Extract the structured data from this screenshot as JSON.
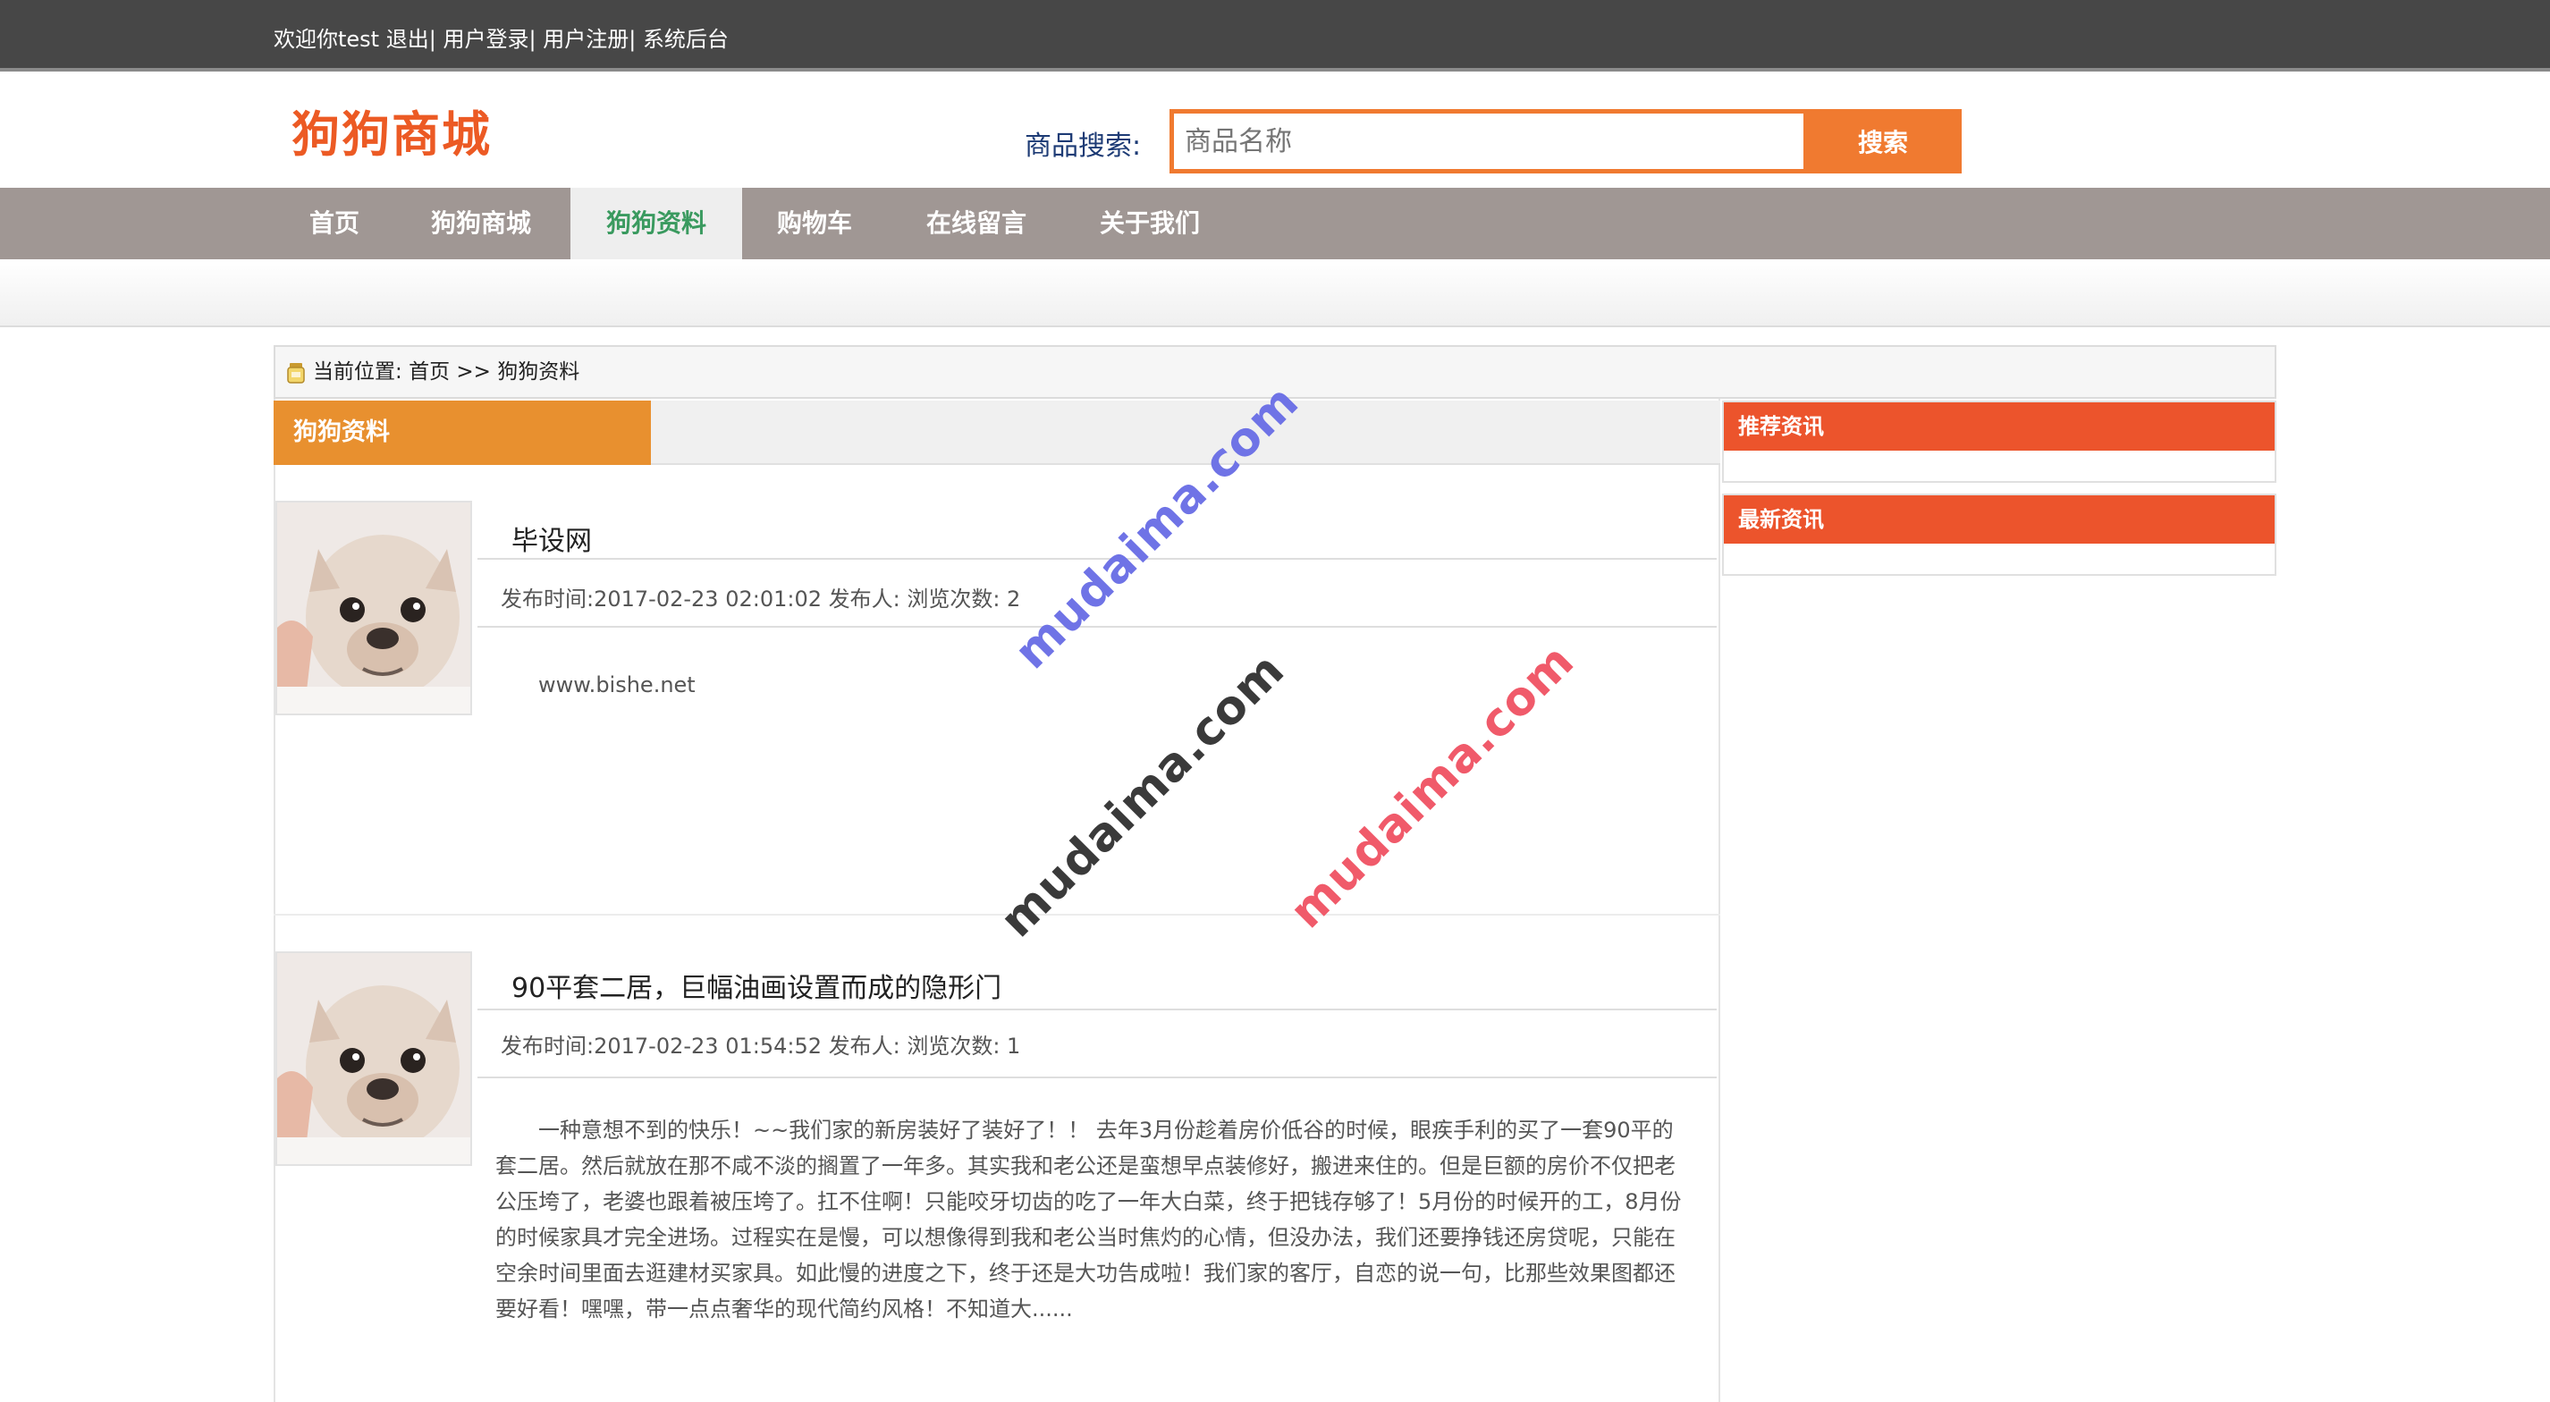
{
  "topbar": {
    "welcome": "欢迎你test",
    "logout": "退出",
    "sep1": "|",
    "login": "用户登录",
    "sep2": "|",
    "register": "用户注册",
    "sep3": "|",
    "admin": "系统后台"
  },
  "header": {
    "logo": "狗狗商城",
    "search_label": "商品搜索:",
    "search_placeholder": "商品名称",
    "search_button": "搜索"
  },
  "nav": {
    "items": [
      {
        "label": "首页"
      },
      {
        "label": "狗狗商城"
      },
      {
        "label": "狗狗资料",
        "active": true
      },
      {
        "label": "购物车"
      },
      {
        "label": "在线留言"
      },
      {
        "label": "关于我们"
      }
    ]
  },
  "breadcrumb": {
    "prefix": "当前位置:",
    "home": "首页",
    "arrow": ">>",
    "current": "狗狗资料"
  },
  "section": {
    "title": "狗狗资料"
  },
  "articles": [
    {
      "title": "毕设网",
      "meta": "发布时间:2017-02-23 02:01:02 发布人: 浏览次数: 2",
      "body": "www.bishe.net"
    },
    {
      "title": "90平套二居，巨幅油画设置而成的隐形门",
      "meta": "发布时间:2017-02-23 01:54:52 发布人: 浏览次数: 1",
      "body": "一种意想不到的快乐！~~我们家的新房装好了装好了！！ 去年3月份趁着房价低谷的时候，眼疾手利的买了一套90平的套二居。然后就放在那不咸不淡的搁置了一年多。其实我和老公还是蛮想早点装修好，搬进来住的。但是巨额的房价不仅把老公压垮了，老婆也跟着被压垮了。扛不住啊！只能咬牙切齿的吃了一年大白菜，终于把钱存够了！5月份的时候开的工，8月份的时候家具才完全进场。过程实在是慢，可以想像得到我和老公当时焦灼的心情，但没办法，我们还要挣钱还房贷呢，只能在空余时间里面去逛建材买家具。如此慢的进度之下，终于还是大功告成啦！我们家的客厅，自恋的说一句，比那些效果图都还要好看！嘿嘿，带一点点奢华的现代简约风格！不知道大......"
    }
  ],
  "sidebar": {
    "recommended": "推荐资讯",
    "latest": "最新资讯"
  },
  "watermarks": {
    "wm1": "mudaima.com",
    "wm2": "mudaima.com",
    "wm3": "mudaima.com"
  },
  "colors": {
    "accent_orange": "#f07a30",
    "logo_red": "#ec5a24",
    "nav_bg": "#a09794",
    "active_nav_text": "#3a9a5f",
    "section_tab": "#e8902f",
    "sidebar_head": "#ec542c"
  }
}
